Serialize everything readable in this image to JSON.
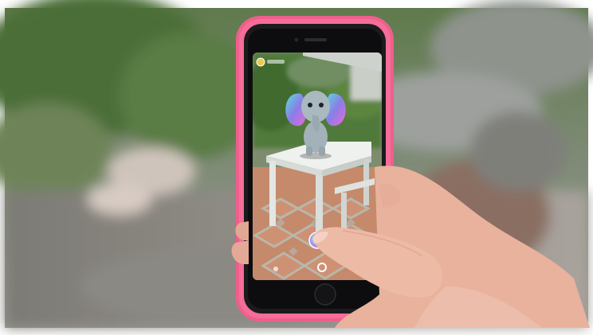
{
  "scene": {
    "description_free": true,
    "colors": {
      "case_pink": "#f0608f",
      "foliage_green": "#4c7a3e",
      "blur_background": "#8d8f86",
      "table_white": "#e9ece9",
      "tile_terracotta": "#c98a6c",
      "skin": "#e8b39f",
      "elephant_grey": "#a7b6bb"
    },
    "icons": [
      "profile-icon",
      "shutter-icon",
      "lens-carousel-icon"
    ]
  }
}
